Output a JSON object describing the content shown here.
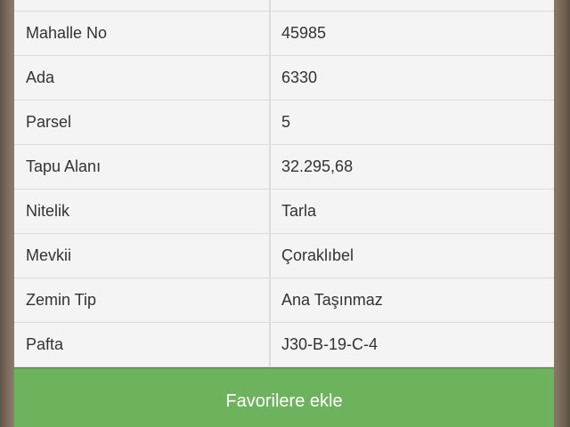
{
  "parcel_info": {
    "rows": [
      {
        "label": "",
        "value": ""
      },
      {
        "label": "Mahalle No",
        "value": "45985"
      },
      {
        "label": "Ada",
        "value": "6330"
      },
      {
        "label": "Parsel",
        "value": "5"
      },
      {
        "label": "Tapu Alanı",
        "value": "32.295,68"
      },
      {
        "label": "Nitelik",
        "value": "Tarla"
      },
      {
        "label": "Mevkii",
        "value": "Çoraklıbel"
      },
      {
        "label": "Zemin Tip",
        "value": "Ana Taşınmaz"
      },
      {
        "label": "Pafta",
        "value": "J30-B-19-C-4"
      }
    ]
  },
  "actions": {
    "favorite_label": "Favorilere ekle"
  },
  "colors": {
    "button_bg": "#6db35e",
    "button_text": "#ffffff",
    "panel_bg": "#f4f4f4",
    "text": "#333333"
  }
}
